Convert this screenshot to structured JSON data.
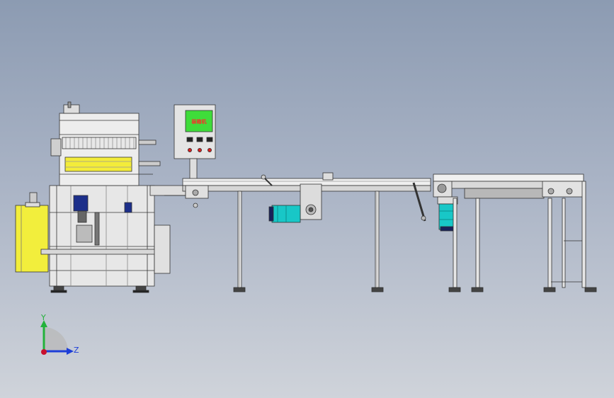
{
  "viewport": {
    "background_top": "#8c9bb2",
    "background_bottom": "#cfd3da"
  },
  "hmi_panel": {
    "screen_text": "装箱机",
    "screen_color": "#3fdc3a"
  },
  "motors": {
    "body_color": "#18c7c7",
    "cap_color": "#17215a"
  },
  "axes": {
    "y_label": "Y",
    "z_label": "Z",
    "y_color": "#23b23a",
    "z_color": "#1d3ed8",
    "x_color": "#c8102e"
  }
}
